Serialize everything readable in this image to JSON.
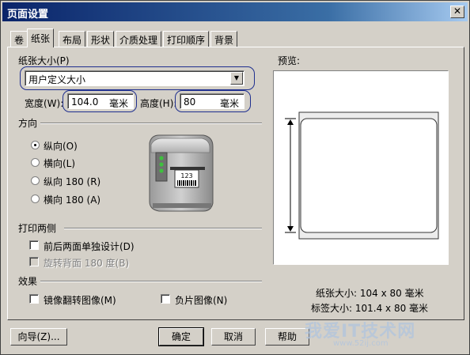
{
  "window": {
    "title": "页面设置",
    "close_glyph": "✕"
  },
  "tabs": [
    {
      "label": "卷",
      "active": false
    },
    {
      "label": "纸张",
      "active": true
    },
    {
      "label": "布局",
      "active": false
    },
    {
      "label": "形状",
      "active": false
    },
    {
      "label": "介质处理",
      "active": false
    },
    {
      "label": "打印顺序",
      "active": false
    },
    {
      "label": "背景",
      "active": false
    }
  ],
  "paper": {
    "group_label": "纸张大小(P)",
    "size_value": "用户定义大小",
    "width_label": "宽度(W):",
    "width_value": "104.0",
    "width_unit": "毫米",
    "height_label": "高度(H):",
    "height_value": "80",
    "height_unit": "毫米"
  },
  "orientation": {
    "group_label": "方向",
    "options": [
      {
        "label": "纵向(O)",
        "selected": true
      },
      {
        "label": "横向(L)",
        "selected": false
      },
      {
        "label": "纵向 180 (R)",
        "selected": false
      },
      {
        "label": "横向 180 (A)",
        "selected": false
      }
    ],
    "printer_label_text": "123"
  },
  "duplex": {
    "group_label": "打印两侧",
    "options": [
      {
        "label": "前后两面单独设计(D)",
        "checked": false,
        "enabled": true
      },
      {
        "label": "旋转背面 180 度(B)",
        "checked": false,
        "enabled": false
      }
    ]
  },
  "effects": {
    "group_label": "效果",
    "mirror_label": "镜像翻转图像(M)",
    "negative_label": "负片图像(N)"
  },
  "preview": {
    "label": "预览:",
    "paper_size": "纸张大小: 104 x 80 毫米",
    "label_size": "标签大小: 101.4 x 80 毫米"
  },
  "buttons": {
    "wizard": "向导(Z)...",
    "ok": "确定",
    "cancel": "取消",
    "help": "帮助"
  },
  "watermark": {
    "text": "我爱IT技术网",
    "url": "www.52ij.com"
  },
  "colors": {
    "title_bar": "#0a246a",
    "highlight": "#1f2f8f",
    "dialog_bg": "#d4d0c8"
  }
}
